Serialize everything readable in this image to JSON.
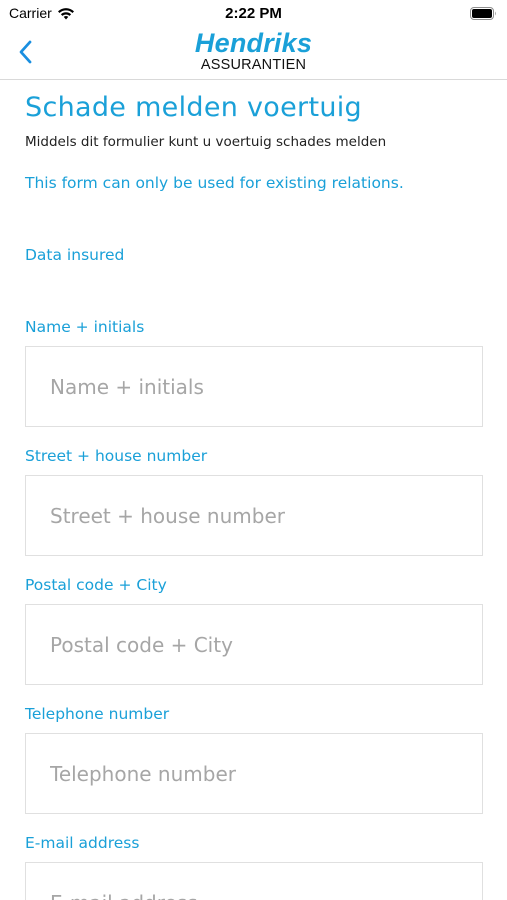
{
  "status_bar": {
    "carrier": "Carrier",
    "time": "2:22 PM"
  },
  "nav": {
    "logo_name": "Hendriks",
    "logo_sub": "ASSURANTIEN",
    "accent_color": "#1aa0d8"
  },
  "form": {
    "title": "Schade melden voertuig",
    "subtitle": "Middels dit formulier kunt u voertuig schades melden",
    "notice": "This form can only be used for existing relations.",
    "section": "Data insured",
    "fields": [
      {
        "label": "Name + initials",
        "placeholder": "Name + initials",
        "value": ""
      },
      {
        "label": "Street + house number",
        "placeholder": "Street + house number",
        "value": ""
      },
      {
        "label": "Postal code + City",
        "placeholder": "Postal code + City",
        "value": ""
      },
      {
        "label": "Telephone number",
        "placeholder": "Telephone number",
        "value": ""
      },
      {
        "label": "E-mail address",
        "placeholder": "E-mail address",
        "value": ""
      }
    ]
  }
}
